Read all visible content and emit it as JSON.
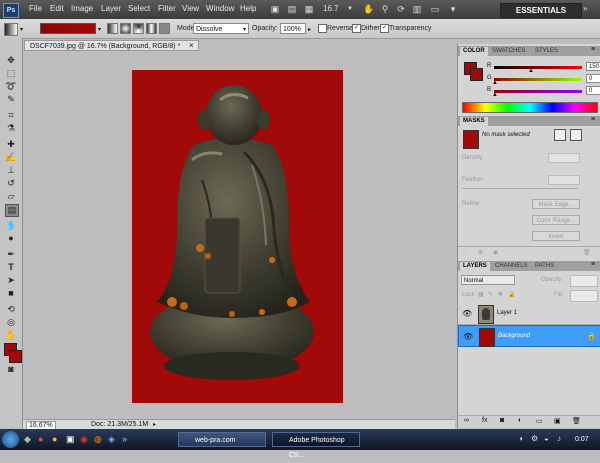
{
  "app": {
    "logo": "Ps"
  },
  "menubar": {
    "items": [
      "File",
      "Edit",
      "Image",
      "Layer",
      "Select",
      "Filter",
      "View",
      "Window",
      "Help"
    ],
    "zoom": "16.7",
    "workspace": "ESSENTIALS"
  },
  "options": {
    "mode_label": "Mode:",
    "mode_value": "Dissolve",
    "opacity_label": "Opacity:",
    "opacity_value": "100%",
    "reverse_label": "Reverse",
    "dither_label": "Dither",
    "transparency_label": "Transparency",
    "foreground_color": "#a20909"
  },
  "document": {
    "tab_title": "DSCF7039.jpg @ 16.7% (Background, RGB/8) *",
    "background_color": "#a20909"
  },
  "status": {
    "zoom": "16.67%",
    "doc_info": "Doc: 21.3M/25.1M"
  },
  "color_panel": {
    "tabs": [
      "COLOR",
      "SWATCHES",
      "STYLES"
    ],
    "r_label": "R",
    "r_value": "150",
    "g_label": "G",
    "g_value": "0",
    "b_label": "B",
    "b_value": "0"
  },
  "masks_panel": {
    "title": "MASKS",
    "status": "No mask selected",
    "density_label": "Density:",
    "feather_label": "Feather:",
    "refine_label": "Refine:",
    "mask_edge": "Mask Edge...",
    "color_range": "Color Range...",
    "invert": "Invert"
  },
  "layers_panel": {
    "tabs": [
      "LAYERS",
      "CHANNELS",
      "PATHS"
    ],
    "blend_mode": "Normal",
    "opacity_label": "Opacity:",
    "fill_label": "Fill:",
    "lock_label": "Lock:",
    "layers": [
      {
        "name": "Layer 1",
        "selected": false
      },
      {
        "name": "Background",
        "selected": true
      }
    ]
  },
  "taskbar": {
    "tasks": [
      "web-pra.com",
      "Adobe Photoshop CS..."
    ],
    "clock": "0:07"
  }
}
